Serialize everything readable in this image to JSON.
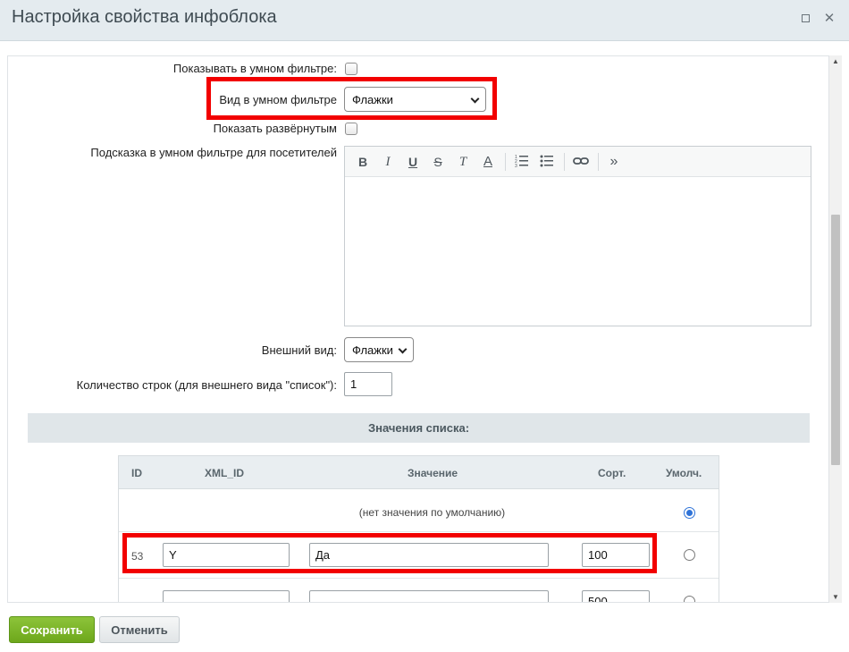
{
  "window": {
    "title": "Настройка свойства инфоблока"
  },
  "form": {
    "smart_filter_show_label": "Показывать в умном фильтре:",
    "smart_filter_view_label": "Вид в умном фильтре",
    "smart_filter_view_value": "Флажки",
    "show_expanded_label": "Показать развёрнутым",
    "hint_label": "Подсказка в умном фильтре для посетителей",
    "appearance_label": "Внешний вид:",
    "appearance_value": "Флажки",
    "rows_count_label": "Количество строк (для внешнего вида \"список\"):",
    "rows_count_value": "1"
  },
  "editor": {
    "toolbar": {
      "bold": "B",
      "italic": "I",
      "underline": "U",
      "strike": "S",
      "clear_format": "T",
      "text_color": "A",
      "more": "»"
    }
  },
  "list_values": {
    "section_title": "Значения списка:",
    "headers": {
      "id": "ID",
      "xml_id": "XML_ID",
      "value": "Значение",
      "sort": "Сорт.",
      "default": "Умолч."
    },
    "no_default_text": "(нет значения по умолчанию)",
    "rows": [
      {
        "id": "53",
        "xml_id": "Y",
        "value": "Да",
        "sort": "100"
      },
      {
        "id": "",
        "xml_id": "",
        "value": "",
        "sort": "500"
      }
    ]
  },
  "buttons": {
    "save": "Сохранить",
    "cancel": "Отменить"
  },
  "colors": {
    "highlight": "#f20000",
    "save_green": "#7ab52a"
  }
}
